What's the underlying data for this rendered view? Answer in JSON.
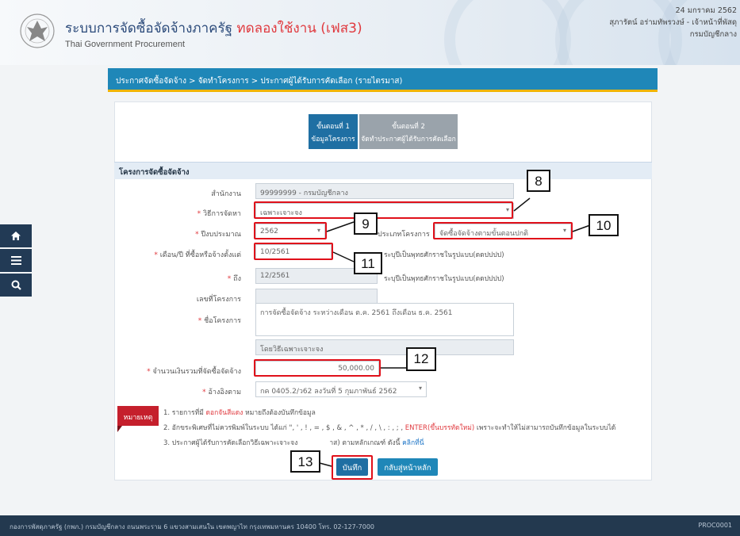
{
  "header": {
    "title": "ระบบการจัดซื้อจัดจ้างภาครัฐ ",
    "title_trial": "ทดลองใช้งาน (เฟส3)",
    "subtitle": "Thai Government Procurement",
    "date": "24 มกราคม 2562",
    "user": "สุภารัตน์ อร่ามทัพรวงษ์ - เจ้าหน้าที่พัสดุ",
    "org": "กรมบัญชีกลาง"
  },
  "breadcrumb": "ประกาศจัดซื้อจัดจ้าง > จัดทำโครงการ > ประกาศผู้ได้รับการคัดเลือก (รายไตรมาส)",
  "steps": [
    {
      "title": "ขั้นตอนที่ 1",
      "label": "ข้อมูลโครงการ"
    },
    {
      "title": "ขั้นตอนที่ 2",
      "label": "จัดทำประกาศผู้ได้รับการคัดเลือก"
    }
  ],
  "section_title": "โครงการจัดซื้อจัดจ้าง",
  "form": {
    "agency_label": "สำนักงาน",
    "agency_value": "99999999 - กรมบัญชีกลาง",
    "method_label": "วิธีการจัดหา",
    "method_value": "เฉพาะเจาะจง",
    "budget_year_label": "ปีงบประมาณ",
    "budget_year_value": "2562",
    "project_type_label": "ประเภทโครงการ",
    "project_type_value": "จัดซื้อจัดจ้างตามขั้นตอนปกติ",
    "start_label": "เดือน/ปี ที่ซื้อหรือจ้างตั้งแต่",
    "start_value": "10/2561",
    "start_hint": "ระบุปีเป็นพุทธศักราชในรูปแบบ(ดดปปปป)",
    "end_label": "ถึง",
    "end_value": "12/2561",
    "end_hint": "ระบุปีเป็นพุทธศักราชในรูปแบบ(ดดปปปป)",
    "project_no_label": "เลขที่โครงการ",
    "project_name_label": "ชื่อโครงการ",
    "project_name_value": "การจัดซื้อจัดจ้าง ระหว่างเดือน ต.ค. 2561 ถึงเดือน ธ.ค. 2561",
    "project_suffix": "โดยวิธีเฉพาะเจาะจง",
    "amount_label": "จำนวนเงินรวมที่จัดซื้อจัดจ้าง",
    "amount_value": "50,000.00",
    "reference_label": "อ้างอิงตาม",
    "reference_value": "กค 0405.2/ว62 ลงวันที่ 5 กุมภาพันธ์ 2562"
  },
  "notes": {
    "tag": "หมายเหตุ",
    "n1_prefix": "1. รายการที่มี ",
    "n1_red": "ดอกจันสีแดง",
    "n1_suffix": " หมายถึงต้องบันทึกข้อมูล",
    "n2_prefix": "2. อักขระพิเศษที่ไม่ควรพิมพ์ในระบบ ได้แก่ \", ' , ! , = , $ , & , ^ , * , / , \\ , : , ; , ",
    "n2_red": "ENTER(ขึ้นบรรทัดใหม่)",
    "n2_suffix": " เพราะจะทำให้ไม่สามารถบันทึกข้อมูลในระบบได้",
    "n3_prefix": "3. ประกาศผู้ได้รับการคัดเลือกวิธีเฉพาะเจาะจง",
    "n3_mid": "าส) ตามหลักเกณฑ์ ดังนี้ ",
    "n3_link": "คลิกที่นี่"
  },
  "buttons": {
    "save": "บันทึก",
    "back": "กลับสู่หน้าหลัก"
  },
  "callouts": [
    "8",
    "9",
    "10",
    "11",
    "12",
    "13"
  ],
  "footer": {
    "text": "กองการพัสดุภาครัฐ (กพภ.) กรมบัญชีกลาง ถนนพระราม 6 แขวงสามเสนใน เขตพญาไท กรุงเทพมหานคร 10400 โทร. 02-127-7000",
    "code": "PROC0001"
  },
  "colors": {
    "brand_blue": "#1f87b8",
    "accent_yellow": "#f0b400",
    "highlight_red": "#e0101a"
  }
}
